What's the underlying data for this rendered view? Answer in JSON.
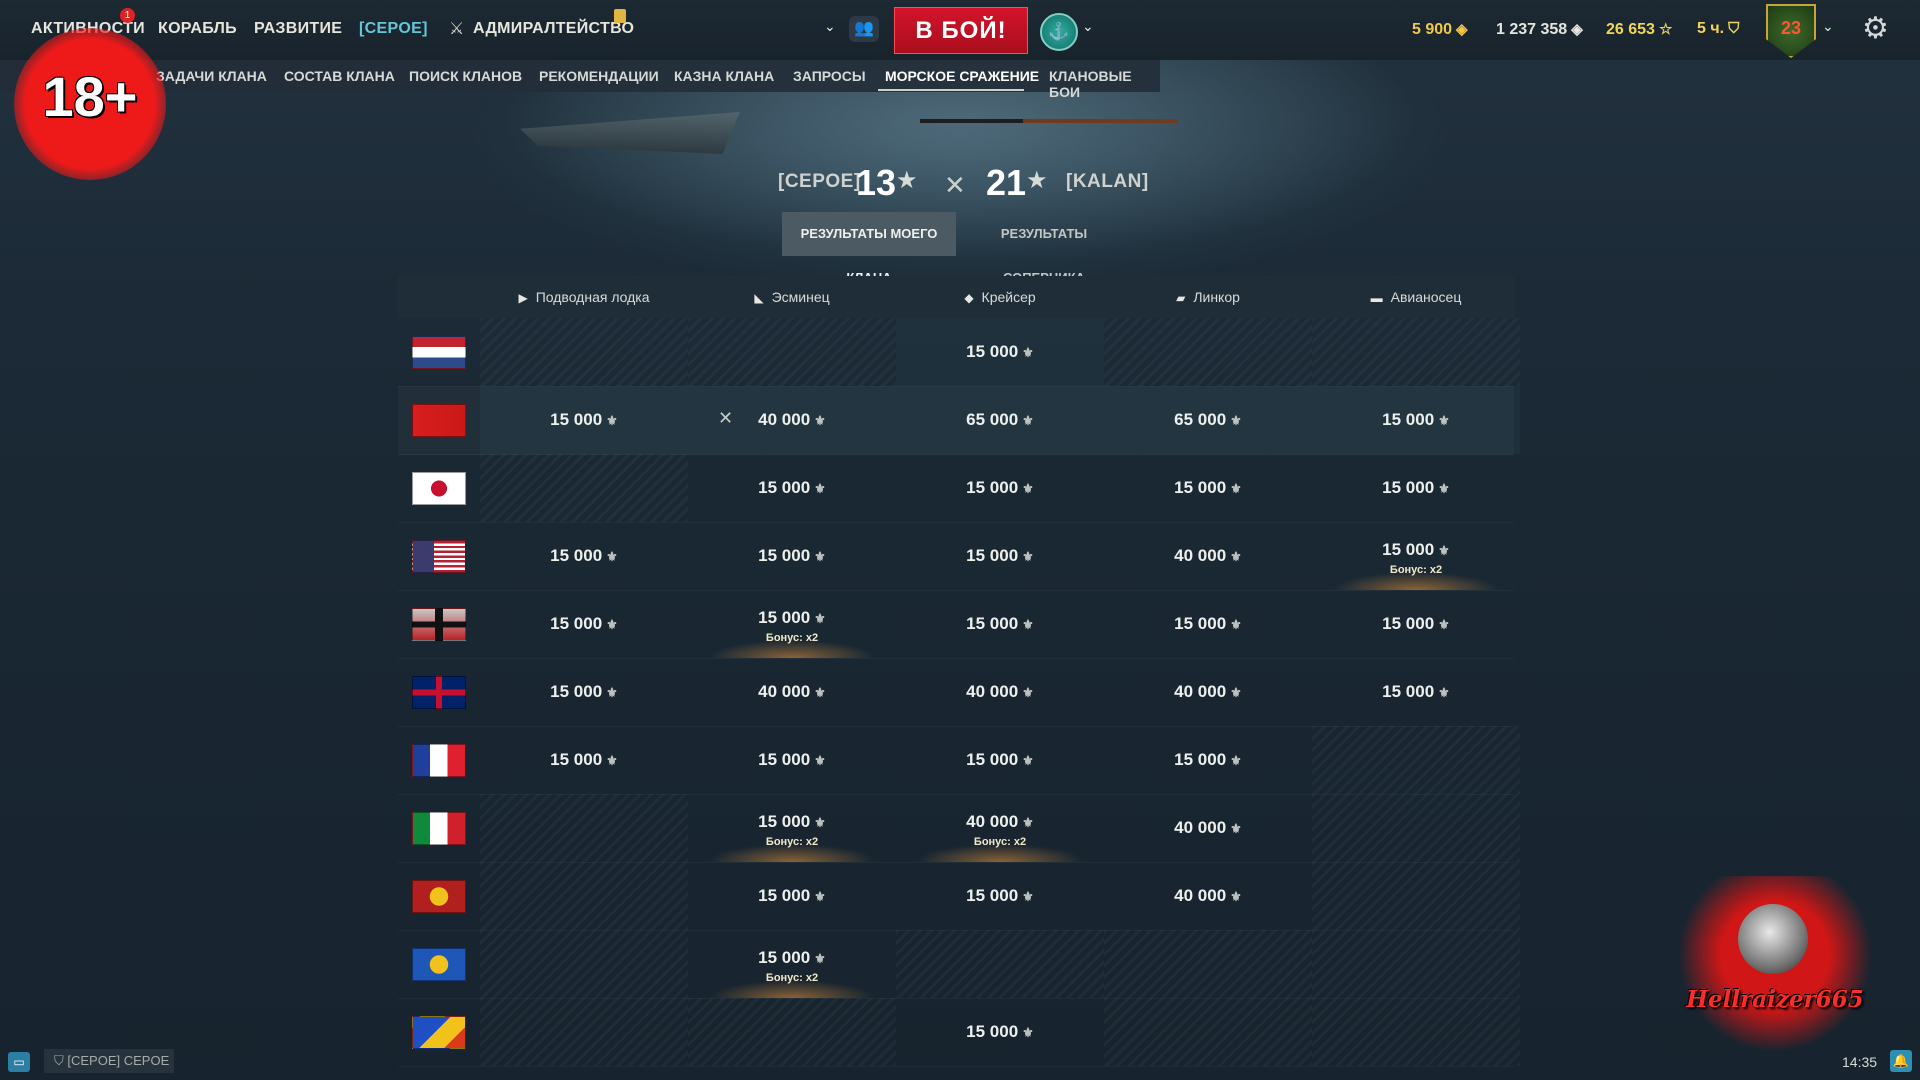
{
  "topnav": {
    "activities": "АКТИВНОСТИ",
    "activities_badge": "1",
    "ship": "КОРАБЛЬ",
    "development": "РАЗВИТИЕ",
    "clan_tag": "[CEPOE]",
    "admiralty": "АДМИРАЛТЕЙСТВО",
    "battle_button": "В БОЙ!"
  },
  "currency": {
    "doubloons": "5 900",
    "credits": "1 237 358",
    "free_xp": "26 653",
    "premium_time": "5 ч."
  },
  "emblem_text": "23",
  "subnav": [
    "ЗАДАЧИ КЛАНА",
    "СОСТАВ КЛАНА",
    "ПОИСК КЛАНОВ",
    "РЕКОМЕНДАЦИИ",
    "КАЗНА КЛАНА",
    "ЗАПРОСЫ",
    "МОРСКОЕ СРАЖЕНИЕ",
    "КЛАНОВЫЕ БОИ"
  ],
  "progress_fraction": 0.4,
  "age_badge": "18+",
  "score": {
    "left_tag": "[CEPOE]",
    "left_stars": "13",
    "right_stars": "21",
    "right_tag": "[KALAN]",
    "star_glyph": "★"
  },
  "results_tabs": {
    "mine": "РЕЗУЛЬТАТЫ МОЕГО КЛАНА",
    "opponent": "РЕЗУЛЬТАТЫ СОПЕРНИКА"
  },
  "table": {
    "columns": [
      "Подводная лодка",
      "Эсминец",
      "Крейсер",
      "Линкор",
      "Авианосец"
    ],
    "bonus_label": "Бонус: x2",
    "rows": [
      {
        "nation": "Netherlands",
        "cells": [
          "",
          "",
          "15 000",
          "",
          ""
        ],
        "bonus": [
          false,
          false,
          false,
          false,
          false
        ],
        "lost": [
          false,
          false,
          false,
          false,
          false
        ]
      },
      {
        "nation": "USSR",
        "cells": [
          "15 000",
          "40 000",
          "65 000",
          "65 000",
          "15 000"
        ],
        "bonus": [
          false,
          false,
          false,
          false,
          false
        ],
        "lost": [
          false,
          true,
          false,
          false,
          false
        ]
      },
      {
        "nation": "Japan",
        "cells": [
          "",
          "15 000",
          "15 000",
          "15 000",
          "15 000"
        ],
        "bonus": [
          false,
          false,
          false,
          false,
          false
        ],
        "lost": [
          false,
          false,
          false,
          false,
          false
        ]
      },
      {
        "nation": "USA",
        "cells": [
          "15 000",
          "15 000",
          "15 000",
          "40 000",
          "15 000"
        ],
        "bonus": [
          false,
          false,
          false,
          false,
          true
        ],
        "lost": [
          false,
          false,
          false,
          false,
          false
        ]
      },
      {
        "nation": "Germany",
        "cells": [
          "15 000",
          "15 000",
          "15 000",
          "15 000",
          "15 000"
        ],
        "bonus": [
          false,
          true,
          false,
          false,
          false
        ],
        "lost": [
          false,
          false,
          false,
          false,
          false
        ]
      },
      {
        "nation": "UK",
        "cells": [
          "15 000",
          "40 000",
          "40 000",
          "40 000",
          "15 000"
        ],
        "bonus": [
          false,
          false,
          false,
          false,
          false
        ],
        "lost": [
          false,
          false,
          false,
          false,
          false
        ]
      },
      {
        "nation": "France",
        "cells": [
          "15 000",
          "15 000",
          "15 000",
          "15 000",
          ""
        ],
        "bonus": [
          false,
          false,
          false,
          false,
          false
        ],
        "lost": [
          false,
          false,
          false,
          false,
          false
        ]
      },
      {
        "nation": "Italy",
        "cells": [
          "",
          "15 000",
          "40 000",
          "40 000",
          ""
        ],
        "bonus": [
          false,
          true,
          true,
          false,
          false
        ],
        "lost": [
          false,
          false,
          false,
          false,
          false
        ]
      },
      {
        "nation": "Pan-Asia",
        "cells": [
          "",
          "15 000",
          "15 000",
          "40 000",
          ""
        ],
        "bonus": [
          false,
          false,
          false,
          false,
          false
        ],
        "lost": [
          false,
          false,
          false,
          false,
          false
        ]
      },
      {
        "nation": "Commonwealth",
        "cells": [
          "",
          "15 000",
          "",
          "",
          ""
        ],
        "bonus": [
          false,
          true,
          false,
          false,
          false
        ],
        "lost": [
          false,
          false,
          false,
          false,
          false
        ]
      },
      {
        "nation": "Pan-America",
        "cells": [
          "",
          "",
          "15 000",
          "",
          ""
        ],
        "bonus": [
          false,
          false,
          false,
          false,
          false
        ],
        "lost": [
          false,
          false,
          false,
          false,
          false
        ]
      }
    ]
  },
  "bottom": {
    "clan_chip": "[CEPOE] CEPOE",
    "clock": "14:35"
  },
  "streamer_name": "Hellraizer665",
  "colors": {
    "battle_button": "#d3142a",
    "clan_tag": "#63c7d8",
    "gold": "#f2c84b",
    "background": "#1a2733"
  }
}
